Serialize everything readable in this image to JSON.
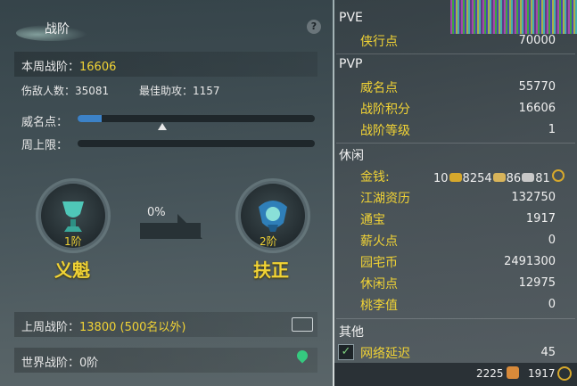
{
  "left": {
    "title": "战阶",
    "help": "?",
    "week_rank_label": "本周战阶：",
    "week_rank_value": "16606",
    "kills_label": "伤敌人数：35081",
    "assist_label": "最佳助攻：1157",
    "fame_label": "威名点：",
    "week_cap_label": "周上限：",
    "fame_fill": 0.1,
    "current_rank": {
      "level": "1阶",
      "name": "义魁"
    },
    "next_rank": {
      "level": "2阶",
      "name": "扶正"
    },
    "progress": "0%",
    "last_week_label": "上周战阶：",
    "last_week_value": "13800 (500名以外)",
    "world_rank": "世界战阶：0阶"
  },
  "right": {
    "pve": "PVE",
    "xiaxing_label": "侠行点",
    "xiaxing_value": "70000",
    "pvp": "PVP",
    "weiming_label": "威名点",
    "weiming_value": "55770",
    "zhanjie_score_label": "战阶积分",
    "zhanjie_score_value": "16606",
    "zhanjie_level_label": "战阶等级",
    "zhanjie_level_value": "1",
    "leisure": "休闲",
    "money_label": "金钱:",
    "money_gold": "10",
    "money_silver": "8254",
    "money_copper": "86",
    "money_other": "81",
    "jianghu_label": "江湖资历",
    "jianghu_value": "132750",
    "tongbao_label": "通宝",
    "tongbao_value": "1917",
    "xinhuo_label": "薪火点",
    "xinhuo_value": "0",
    "yuanzhai_label": "园宅币",
    "yuanzhai_value": "2491300",
    "xiuxian_label": "休闲点",
    "xiuxian_value": "12975",
    "taoli_label": "桃李值",
    "taoli_value": "0",
    "other": "其他",
    "latency_label": "网络延迟",
    "latency_value": "45",
    "bottom_left": "2225",
    "bottom_right": "1917"
  },
  "colors": {
    "accent": "#f1d335",
    "bar": "#3c82c7"
  }
}
